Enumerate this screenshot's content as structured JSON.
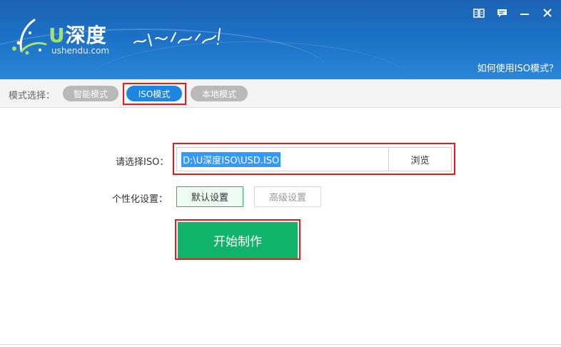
{
  "header": {
    "logo_brand": "深度",
    "logo_u": "U",
    "logo_domain": "ushendu.com",
    "slogan": "装机不再有难度!",
    "help_link": "如何使用ISO模式？"
  },
  "modebar": {
    "label": "模式选择：",
    "modes": [
      "智能模式",
      "ISO模式",
      "本地模式"
    ],
    "active_mode": "ISO模式"
  },
  "form": {
    "iso_label": "请选择ISO：",
    "iso_path": "D:\\U深度ISO\\USD.ISO",
    "browse_label": "浏览",
    "personalize_label": "个性化设置：",
    "default_settings_label": "默认设置",
    "advanced_settings_label": "高级设置",
    "start_label": "开始制作"
  },
  "colors": {
    "header_blue": "#1b70c6",
    "active_pill": "#1d86e0",
    "inactive_pill": "#b9b9b9",
    "start_green": "#0fb36a",
    "highlight_red": "#e41b1b"
  },
  "icons": [
    "menu-book-icon",
    "feedback-icon",
    "minimize-icon",
    "close-icon"
  ]
}
